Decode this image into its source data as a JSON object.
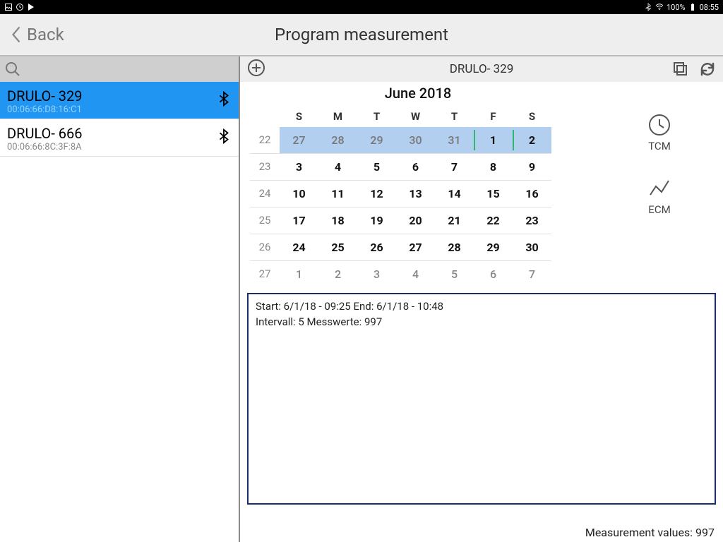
{
  "status": {
    "battery_text": "100%",
    "time": "08:55"
  },
  "header": {
    "back_label": "Back",
    "title": "Program measurement"
  },
  "devices": [
    {
      "name": "DRULO-  329",
      "id": "00:06:66:D8:16:C1",
      "selected": true
    },
    {
      "name": "DRULO-  666",
      "id": "00:06:66:8C:3F:8A",
      "selected": false
    }
  ],
  "toolbar": {
    "device_title": "DRULO-  329"
  },
  "calendar": {
    "month_title": "June 2018",
    "weekdays": [
      "S",
      "M",
      "T",
      "W",
      "T",
      "F",
      "S"
    ],
    "weeks": [
      {
        "num": "22",
        "days": [
          {
            "d": "27",
            "cls": "hl"
          },
          {
            "d": "28",
            "cls": "hl"
          },
          {
            "d": "29",
            "cls": "hl"
          },
          {
            "d": "30",
            "cls": "hl"
          },
          {
            "d": "31",
            "cls": "hl"
          },
          {
            "d": "1",
            "cls": "hl-cur"
          },
          {
            "d": "2",
            "cls": "hl-cur"
          }
        ]
      },
      {
        "num": "23",
        "days": [
          {
            "d": "3",
            "cls": "cur"
          },
          {
            "d": "4",
            "cls": "cur"
          },
          {
            "d": "5",
            "cls": "cur"
          },
          {
            "d": "6",
            "cls": "cur"
          },
          {
            "d": "7",
            "cls": "cur"
          },
          {
            "d": "8",
            "cls": "cur"
          },
          {
            "d": "9",
            "cls": "cur"
          }
        ]
      },
      {
        "num": "24",
        "days": [
          {
            "d": "10",
            "cls": "cur"
          },
          {
            "d": "11",
            "cls": "cur"
          },
          {
            "d": "12",
            "cls": "cur"
          },
          {
            "d": "13",
            "cls": "cur"
          },
          {
            "d": "14",
            "cls": "cur"
          },
          {
            "d": "15",
            "cls": "cur"
          },
          {
            "d": "16",
            "cls": "cur"
          }
        ]
      },
      {
        "num": "25",
        "days": [
          {
            "d": "17",
            "cls": "cur"
          },
          {
            "d": "18",
            "cls": "cur"
          },
          {
            "d": "19",
            "cls": "cur"
          },
          {
            "d": "20",
            "cls": "cur"
          },
          {
            "d": "21",
            "cls": "cur"
          },
          {
            "d": "22",
            "cls": "cur"
          },
          {
            "d": "23",
            "cls": "cur"
          }
        ]
      },
      {
        "num": "26",
        "days": [
          {
            "d": "24",
            "cls": "cur"
          },
          {
            "d": "25",
            "cls": "cur"
          },
          {
            "d": "26",
            "cls": "cur"
          },
          {
            "d": "27",
            "cls": "cur"
          },
          {
            "d": "28",
            "cls": "cur"
          },
          {
            "d": "29",
            "cls": "cur"
          },
          {
            "d": "30",
            "cls": "cur"
          }
        ]
      },
      {
        "num": "27",
        "days": [
          {
            "d": "1",
            "cls": "other"
          },
          {
            "d": "2",
            "cls": "other"
          },
          {
            "d": "3",
            "cls": "other"
          },
          {
            "d": "4",
            "cls": "other"
          },
          {
            "d": "5",
            "cls": "other"
          },
          {
            "d": "6",
            "cls": "other"
          },
          {
            "d": "7",
            "cls": "other"
          }
        ]
      }
    ]
  },
  "modes": {
    "tcm": "TCM",
    "ecm": "ECM"
  },
  "details": {
    "line1": "Start: 6/1/18 - 09:25    End: 6/1/18 - 10:48",
    "line2": "Intervall: 5    Messwerte: 997"
  },
  "footer": {
    "measurement_values": "Measurement values: 997"
  }
}
